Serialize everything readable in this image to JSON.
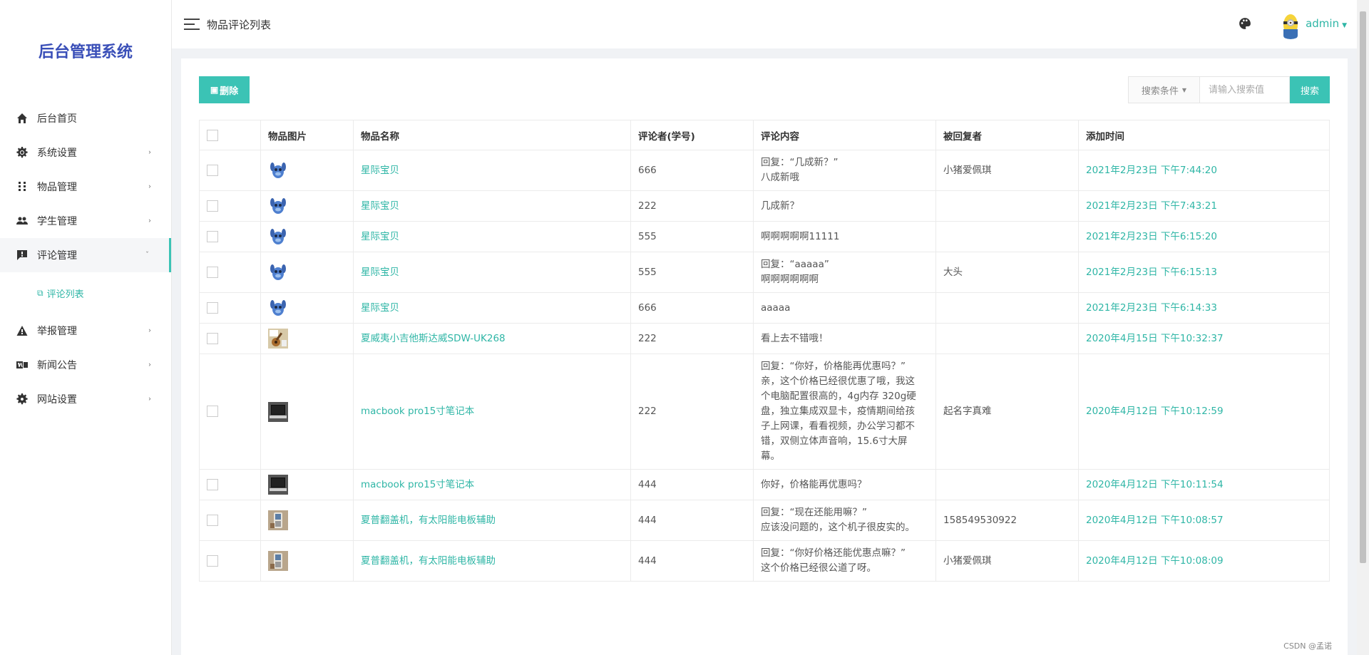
{
  "brand": "后台管理系统",
  "nav": [
    {
      "label": "后台首页",
      "icon": "home-icon"
    },
    {
      "label": "系统设置",
      "icon": "gear-icon"
    },
    {
      "label": "物品管理",
      "icon": "grid-icon"
    },
    {
      "label": "学生管理",
      "icon": "users-icon"
    },
    {
      "label": "评论管理",
      "icon": "comment-icon"
    },
    {
      "label": "举报管理",
      "icon": "warning-icon"
    },
    {
      "label": "新闻公告",
      "icon": "news-icon"
    },
    {
      "label": "网站设置",
      "icon": "gear-icon"
    }
  ],
  "sub_nav": {
    "label": "评论列表",
    "icon": "copy-icon"
  },
  "header": {
    "title": "物品评论列表",
    "user": "admin"
  },
  "toolbar": {
    "delete_label": "删除",
    "search_condition": "搜索条件",
    "search_placeholder": "请输入搜索值",
    "search_label": "搜索"
  },
  "table": {
    "columns": [
      "物品图片",
      "物品名称",
      "评论者(学号)",
      "评论内容",
      "被回复者",
      "添加时间"
    ],
    "rows": [
      {
        "thumb": "stitch",
        "name": "星际宝贝",
        "reviewer": "666",
        "content": [
          "回复：“几成新？”",
          "八成新哦"
        ],
        "reply_to": "小猪爱佩琪",
        "time": "2021年2月23日 下午7:44:20"
      },
      {
        "thumb": "stitch",
        "name": "星际宝贝",
        "reviewer": "222",
        "content": [
          "几成新？"
        ],
        "reply_to": "",
        "time": "2021年2月23日 下午7:43:21"
      },
      {
        "thumb": "stitch",
        "name": "星际宝贝",
        "reviewer": "555",
        "content": [
          "啊啊啊啊啊11111"
        ],
        "reply_to": "",
        "time": "2021年2月23日 下午6:15:20"
      },
      {
        "thumb": "stitch",
        "name": "星际宝贝",
        "reviewer": "555",
        "content": [
          "回复：“aaaaa”",
          "啊啊啊啊啊啊"
        ],
        "reply_to": "大头",
        "time": "2021年2月23日 下午6:15:13"
      },
      {
        "thumb": "stitch",
        "name": "星际宝贝",
        "reviewer": "666",
        "content": [
          "aaaaa"
        ],
        "reply_to": "",
        "time": "2021年2月23日 下午6:14:33"
      },
      {
        "thumb": "guitar",
        "name": "夏威夷小吉他斯达威SDW-UK268",
        "reviewer": "222",
        "content": [
          "看上去不错哦！"
        ],
        "reply_to": "",
        "time": "2020年4月15日 下午10:32:37"
      },
      {
        "thumb": "laptop",
        "name": "macbook pro15寸笔记本",
        "reviewer": "222",
        "content": [
          "回复：“你好，价格能再优惠吗？”",
          "亲，这个价格已经很优惠了哦，我这",
          "个电脑配置很高的，4g内存 320g硬",
          "盘，独立集成双显卡，疫情期间给孩",
          "子上网课，看看视频，办公学习都不",
          "错，双侧立体声音响，15.6寸大屏",
          "幕。"
        ],
        "reply_to": "起名字真难",
        "time": "2020年4月12日 下午10:12:59"
      },
      {
        "thumb": "laptop",
        "name": "macbook pro15寸笔记本",
        "reviewer": "444",
        "content": [
          "你好，价格能再优惠吗？"
        ],
        "reply_to": "",
        "time": "2020年4月12日 下午10:11:54"
      },
      {
        "thumb": "phone",
        "name": "夏普翻盖机，有太阳能电板辅助",
        "reviewer": "444",
        "content": [
          "回复：“现在还能用嘛？”",
          "应该没问题的，这个机子很皮实的。"
        ],
        "reply_to": "158549530922",
        "time": "2020年4月12日 下午10:08:57"
      },
      {
        "thumb": "phone",
        "name": "夏普翻盖机，有太阳能电板辅助",
        "reviewer": "444",
        "content": [
          "回复：“你好价格还能优惠点嘛？”",
          "这个价格已经很公道了呀。"
        ],
        "reply_to": "小猪爱佩琪",
        "time": "2020年4月12日 下午10:08:09"
      }
    ]
  },
  "watermark": "CSDN @孟诺",
  "colors": {
    "accent": "#3bc3b5",
    "brand": "#3a4fb8"
  }
}
